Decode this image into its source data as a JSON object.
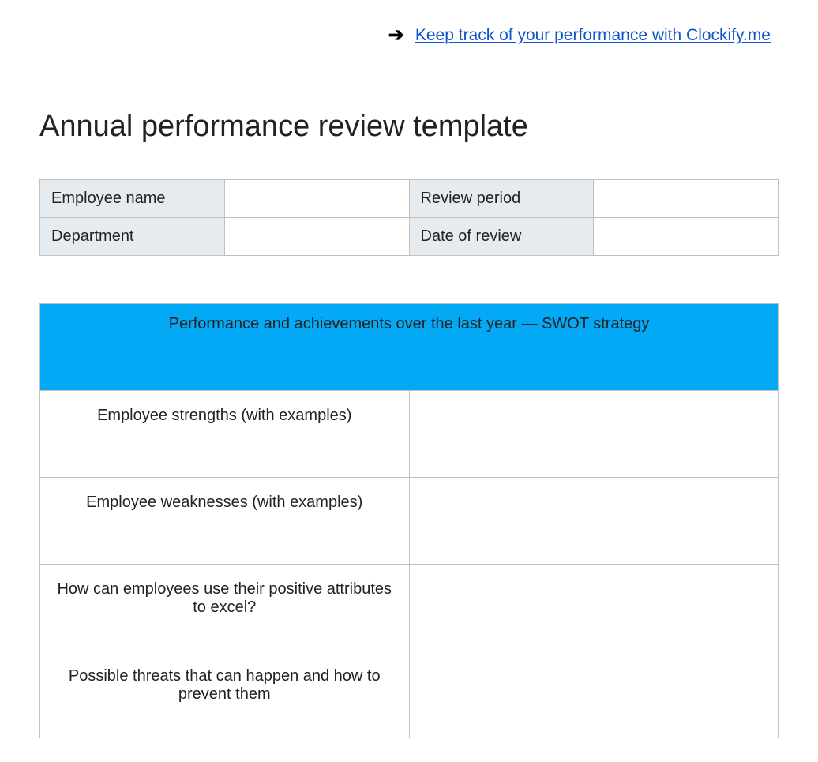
{
  "header": {
    "link_text": "Keep track of your performance with Clockify.me"
  },
  "title": "Annual performance review template",
  "info": {
    "rows": [
      {
        "label1": "Employee name",
        "value1": "",
        "label2": "Review period",
        "value2": ""
      },
      {
        "label1": "Department",
        "value1": "",
        "label2": "Date of review",
        "value2": ""
      }
    ]
  },
  "swot": {
    "heading": "Performance and achievements over the last year — SWOT strategy",
    "rows": [
      {
        "prompt": "Employee strengths (with examples)",
        "response": ""
      },
      {
        "prompt": "Employee weaknesses (with examples)",
        "response": ""
      },
      {
        "prompt": "How can employees use their positive attributes to excel?",
        "response": ""
      },
      {
        "prompt": "Possible threats that can happen and how to prevent them",
        "response": ""
      }
    ]
  }
}
